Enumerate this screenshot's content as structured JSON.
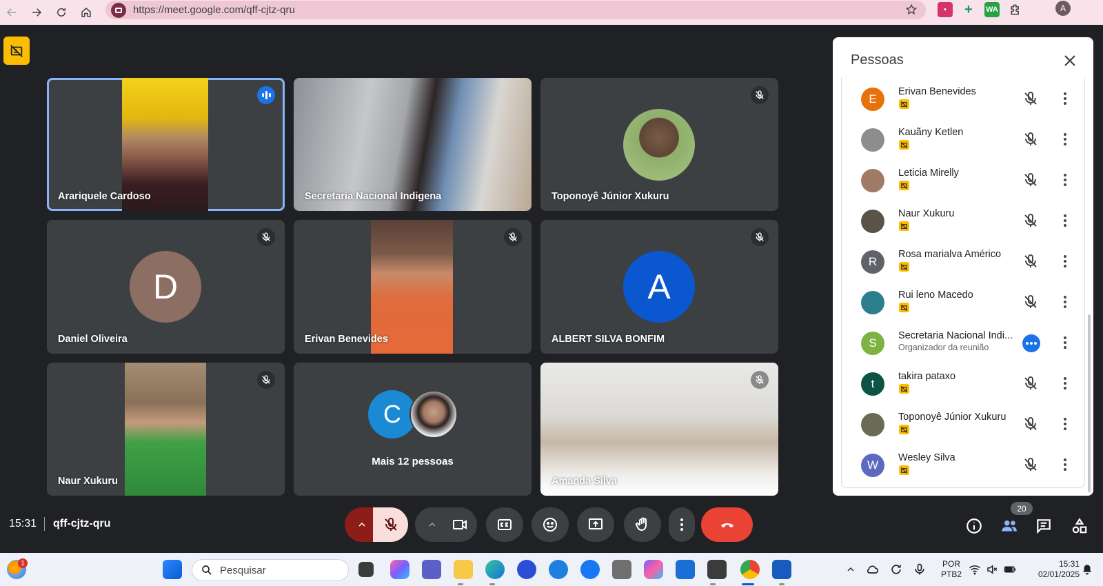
{
  "browser": {
    "url": "https://meet.google.com/qff-cjtz-qru",
    "profile_initial": "A",
    "ext_wa": "WA"
  },
  "tiles": [
    {
      "name": "Arariquele Cardoso",
      "state": "speaking"
    },
    {
      "name": "Secretaria Nacional Indigena",
      "state": "video"
    },
    {
      "name": "Toponoyê Júnior Xukuru",
      "state": "muted"
    },
    {
      "name": "Daniel Oliveira",
      "state": "muted",
      "initial": "D"
    },
    {
      "name": "Erivan Benevides",
      "state": "muted"
    },
    {
      "name": "ALBERT SILVA BONFIM",
      "state": "muted",
      "initial": "A"
    },
    {
      "name": "Naur Xukuru",
      "state": "muted"
    },
    {
      "name": "Mais 12 pessoas",
      "initial": "C"
    },
    {
      "name": "Amanda Silva",
      "state": "muted"
    }
  ],
  "panel": {
    "title": "Pessoas",
    "people": [
      {
        "name": "Erivan Benevides",
        "initial": "E",
        "color": "#e8710a",
        "status": "muted"
      },
      {
        "name": "Kauãny Ketlen",
        "initial": "",
        "color": "#8d8d8d",
        "status": "muted"
      },
      {
        "name": "Leticia Mirelly",
        "initial": "",
        "color": "#a07b66",
        "status": "muted"
      },
      {
        "name": "Naur Xukuru",
        "initial": "",
        "color": "#5b5347",
        "status": "muted"
      },
      {
        "name": "Rosa marialva Américo",
        "initial": "R",
        "color": "#5f6368",
        "status": "muted"
      },
      {
        "name": "Rui leno Macedo",
        "initial": "",
        "color": "#2a7f8a",
        "status": "muted"
      },
      {
        "name": "Secretaria Nacional Indi...",
        "initial": "S",
        "color": "#7cb342",
        "status": "options",
        "subtitle": "Organizador da reunião"
      },
      {
        "name": "takira pataxo",
        "initial": "t",
        "color": "#0b5345",
        "status": "muted"
      },
      {
        "name": "Toponoyê Júnior Xukuru",
        "initial": "",
        "color": "#6b6a55",
        "status": "muted"
      },
      {
        "name": "Wesley Silva",
        "initial": "W",
        "color": "#5c6bc0",
        "status": "muted"
      }
    ]
  },
  "meeting": {
    "time": "15:31",
    "code": "qff-cjtz-qru",
    "participant_count": "20"
  },
  "taskbar": {
    "search_placeholder": "Pesquisar",
    "notification_count": "1",
    "lang_1": "POR",
    "lang_2": "PTB2",
    "clock_time": "15:31",
    "clock_date": "02/01/2025"
  },
  "colors": {
    "meet_bg": "#202124",
    "tile_bg": "#3c4043",
    "accent_blue": "#1a73e8",
    "end_call_red": "#ea4335",
    "mic_off_pink": "#f9dedc",
    "badge_yellow": "#fbbc04"
  }
}
